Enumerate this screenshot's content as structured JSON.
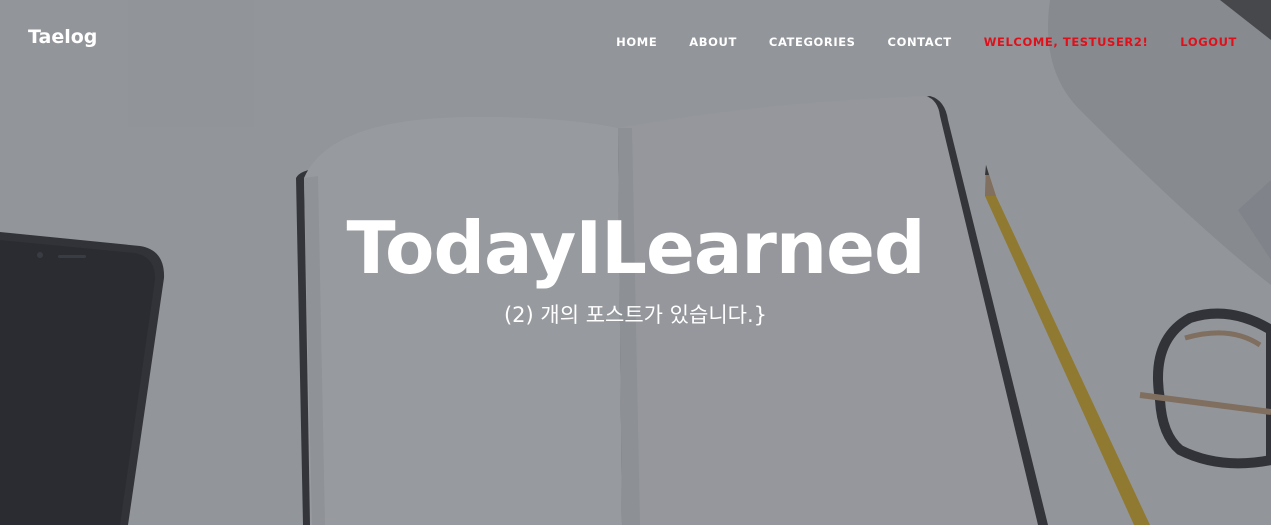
{
  "navbar": {
    "brand": "Taelog",
    "items": [
      {
        "label": "HOME"
      },
      {
        "label": "ABOUT"
      },
      {
        "label": "CATEGORIES"
      },
      {
        "label": "CONTACT"
      },
      {
        "label": "WELCOME, TESTUSER2!"
      },
      {
        "label": "LOGOUT"
      }
    ]
  },
  "hero": {
    "title": "TodayILearned",
    "subheading": "(2) 개의 포스트가 있습니다.}"
  },
  "colors": {
    "nav_text": "#ffffff",
    "user_highlight": "#e0101a",
    "overlay": "#373c44"
  }
}
